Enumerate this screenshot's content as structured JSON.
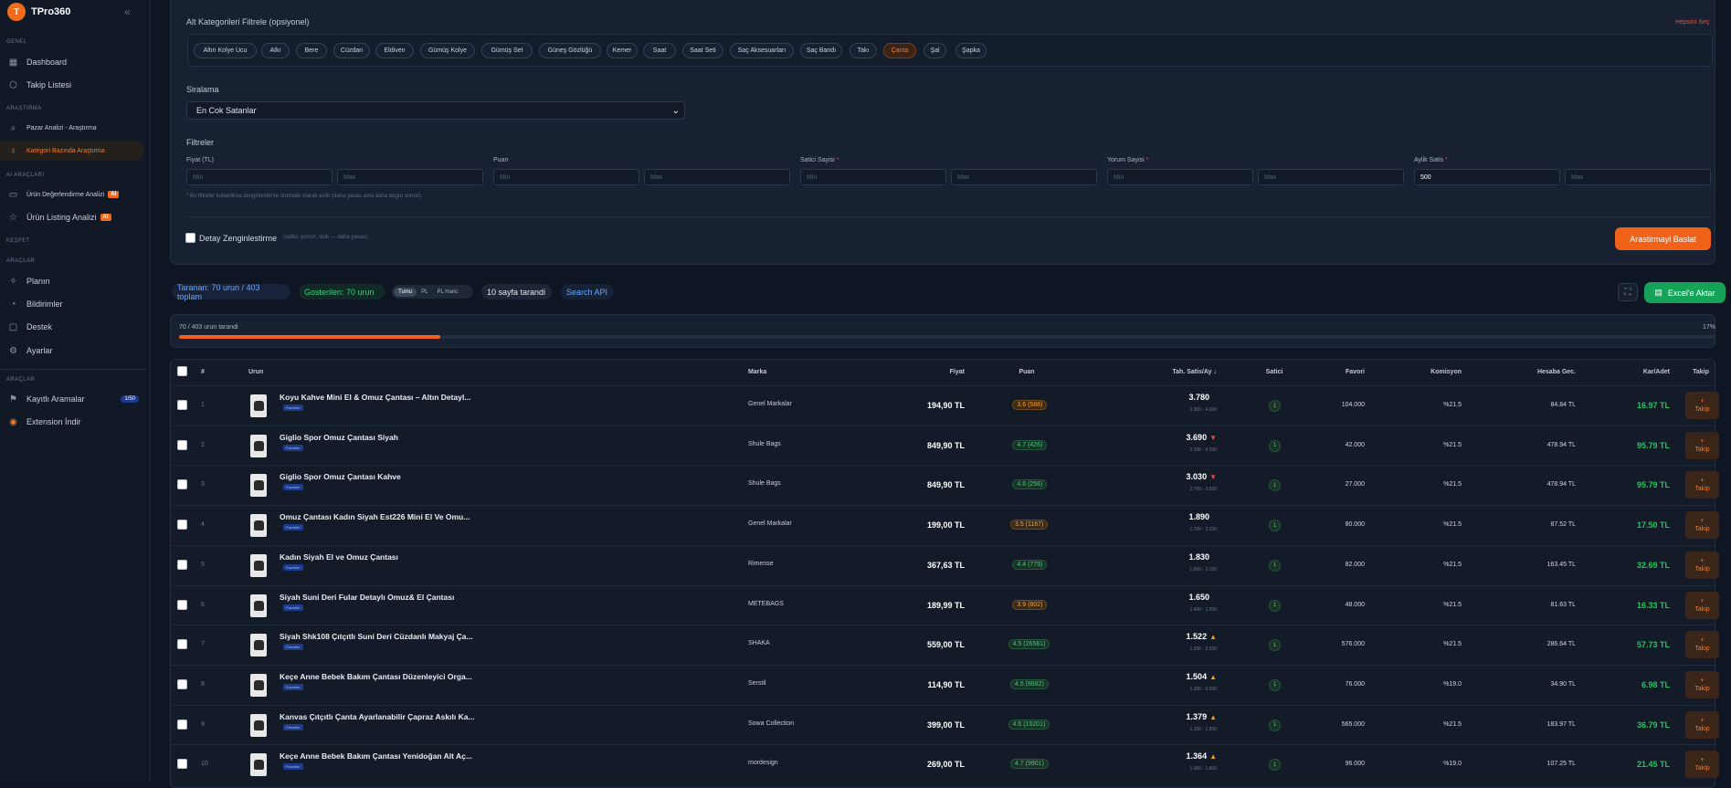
{
  "app": {
    "logo_letter": "T",
    "logo_text": "TPro360"
  },
  "sidebar": {
    "sections": [
      "GENEL",
      "ARAŞTIRMA",
      "AI ARAÇLARI",
      "KEŞFET",
      "ARAÇLAR",
      "ARAÇLAR"
    ],
    "items": [
      {
        "label": "Dashboard"
      },
      {
        "label": "Takip Listesi"
      },
      {
        "label": "Pazar Analizi - Araştırma"
      },
      {
        "label": "Kategori Bazında Araştırma"
      },
      {
        "label": "Ürün Değerlendirme Analizi",
        "badge": "AI"
      },
      {
        "label": "Ürün Listing Analizi",
        "badge": "AI"
      },
      {
        "label": "Planın"
      },
      {
        "label": "Bildirimler"
      },
      {
        "label": "Destek"
      },
      {
        "label": "Ayarlar"
      },
      {
        "label": "Kayıtlı Aramalar",
        "count": "1/50",
        "dot": "4"
      },
      {
        "label": "Extension İndir"
      }
    ]
  },
  "filters": {
    "subcat_title": "Alt Kategorileri Filtrele (opsiyonel)",
    "clear_label": "Hepsini Seç",
    "chips": [
      "Altın Kolye Ucu",
      "Atkı",
      "Bere",
      "Cüzdan",
      "Eldiven",
      "Gümüş Kolye",
      "Gümüş Set",
      "Güneş Gözlüğü",
      "Kemer",
      "Saat",
      "Saat Seti",
      "Saç Aksesuarları",
      "Saç Bandı",
      "Takı",
      "Çanta",
      "Şal",
      "Şapka"
    ],
    "selected_chip": "Çanta",
    "sort_title": "Siralama",
    "sort_value": "En Cok Satanlar",
    "filters_title": "Filtreler",
    "groups": [
      {
        "label": "Fiyat (TL)",
        "required": false,
        "min": "",
        "max": ""
      },
      {
        "label": "Puan",
        "required": false,
        "min": "",
        "max": ""
      },
      {
        "label": "Satici Sayisi",
        "required": true,
        "min": "",
        "max": ""
      },
      {
        "label": "Yorum Sayisi",
        "required": true,
        "min": "",
        "max": ""
      },
      {
        "label": "Aylik Satis",
        "required": true,
        "min": "500",
        "max": ""
      }
    ],
    "min_placeholder": "Min",
    "max_placeholder": "Max",
    "note": "* Bu filtreler kullanilirsa zenginlestirme otomatik olarak acilir (daha yavas ama daha dogru sonuc).",
    "detay_label": "Detay Zenginlestirme",
    "detay_sub": "(satici, yorum, stok — daha yavas)",
    "start_label": "Arastirmayi Baslat"
  },
  "status": {
    "scanned": "Taranan: 70 urun / 403 toplam",
    "shown": "Gosterilen: 70 urun",
    "seg": [
      "Tumu",
      "PL",
      "PL Haric"
    ],
    "pages": "10 sayfa tarandi",
    "api": "Search API",
    "excel": "Excel'e Aktar",
    "progress_text": "70 / 403 urun tarandi",
    "progress_pct": "17%",
    "progress_value": 0.17
  },
  "table": {
    "headers": [
      "#",
      "Urun",
      "Marka",
      "Fiyat",
      "Puan",
      "Tah. Satis/Ay ↓",
      "Satici",
      "Favori",
      "Komisyon",
      "Hesaba Gec.",
      "Kar/Adet",
      "Takip"
    ],
    "row_badge": "Favoriler",
    "takip_label": "+\nTakip",
    "rows": [
      {
        "n": "1",
        "name": "Koyu Kahve Mini El & Omuz Çantası – Altın Detayl...",
        "brand": "Genel Markalar",
        "price": "194,90 TL",
        "rating": "3.6 (588)",
        "rc": "orange",
        "sales": "3.780",
        "trend": "",
        "range": "3.300 - 4.300",
        "seller": "1",
        "fav": "104.000",
        "kom": "%21.5",
        "hes": "84.84 TL",
        "kar": "16.97 TL"
      },
      {
        "n": "2",
        "name": "Giglio Spor Omuz Çantası Siyah",
        "brand": "Shule Bags",
        "price": "849,90 TL",
        "rating": "4.7 (426)",
        "rc": "green",
        "sales": "3.690",
        "trend": "down",
        "range": "3.200 - 4.200",
        "seller": "1",
        "fav": "42.000",
        "kom": "%21.5",
        "hes": "478.94 TL",
        "kar": "95.79 TL"
      },
      {
        "n": "3",
        "name": "Giglio Spor Omuz Çantası Kahve",
        "brand": "Shule Bags",
        "price": "849,90 TL",
        "rating": "4.6 (256)",
        "rc": "green",
        "sales": "3.030",
        "trend": "down",
        "range": "2.700 - 3.500",
        "seller": "1",
        "fav": "27.000",
        "kom": "%21.5",
        "hes": "478.94 TL",
        "kar": "95.79 TL"
      },
      {
        "n": "4",
        "name": "Omuz Çantası Kadın Siyah Est226 Mini El Ve Omu...",
        "brand": "Genel Markalar",
        "price": "199,00 TL",
        "rating": "3.5 (1167)",
        "rc": "orange",
        "sales": "1.890",
        "trend": "",
        "range": "1.700 - 2.200",
        "seller": "1",
        "fav": "80.000",
        "kom": "%21.5",
        "hes": "87.52 TL",
        "kar": "17.50 TL"
      },
      {
        "n": "5",
        "name": "Kadın Siyah El ve Omuz Çantası",
        "brand": "Rimense",
        "price": "367,63 TL",
        "rating": "4.4 (779)",
        "rc": "green",
        "sales": "1.830",
        "trend": "",
        "range": "1.600 - 2.100",
        "seller": "1",
        "fav": "82.000",
        "kom": "%21.5",
        "hes": "163.45 TL",
        "kar": "32.69 TL"
      },
      {
        "n": "6",
        "name": "Siyah Suni Deri Fular Detaylı Omuz& El Çantası",
        "brand": "METEBAGS",
        "price": "189,99 TL",
        "rating": "3.9 (802)",
        "rc": "orange",
        "sales": "1.650",
        "trend": "",
        "range": "1.400 - 1.900",
        "seller": "1",
        "fav": "48.000",
        "kom": "%21.5",
        "hes": "81.63 TL",
        "kar": "16.33 TL"
      },
      {
        "n": "7",
        "name": "Siyah Shk108 Çıtçıtlı Suni Deri Cüzdanlı Makyaj Ça...",
        "brand": "SHAKA",
        "price": "559,00 TL",
        "rating": "4.5 (26581)",
        "rc": "green",
        "sales": "1.522",
        "trend": "up",
        "range": "1.200 - 2.000",
        "seller": "1",
        "fav": "576.000",
        "kom": "%21.5",
        "hes": "286.64 TL",
        "kar": "57.73 TL"
      },
      {
        "n": "8",
        "name": "Keçe Anne Bebek Bakım Çantası Düzenleyici Orga...",
        "brand": "Serstil",
        "price": "114,90 TL",
        "rating": "4.5 (8682)",
        "rc": "green",
        "sales": "1.504",
        "trend": "up",
        "range": "1.200 - 2.000",
        "seller": "1",
        "fav": "76.000",
        "kom": "%19.0",
        "hes": "34.90 TL",
        "kar": "6.98 TL"
      },
      {
        "n": "9",
        "name": "Kanvas Çıtçıtlı Çanta Ayarlanabilir Çapraz Askılı Ka...",
        "brand": "Sowa Collection",
        "price": "399,00 TL",
        "rating": "4.6 (15201)",
        "rc": "green",
        "sales": "1.379",
        "trend": "up",
        "range": "1.100 - 1.800",
        "seller": "1",
        "fav": "565.000",
        "kom": "%21.5",
        "hes": "183.97 TL",
        "kar": "36.79 TL"
      },
      {
        "n": "10",
        "name": "Keçe Anne Bebek Bakım Çantası Yenidoğan Alt Aç...",
        "brand": "mordesign",
        "price": "269,00 TL",
        "rating": "4.7 (9901)",
        "rc": "green",
        "sales": "1.364",
        "trend": "up",
        "range": "1.000 - 1.800",
        "seller": "1",
        "fav": "96.000",
        "kom": "%19.0",
        "hes": "107.25 TL",
        "kar": "21.45 TL"
      }
    ]
  },
  "colors": {
    "accent": "#f06218",
    "green": "#22c55e",
    "bg": "#0f1623"
  }
}
